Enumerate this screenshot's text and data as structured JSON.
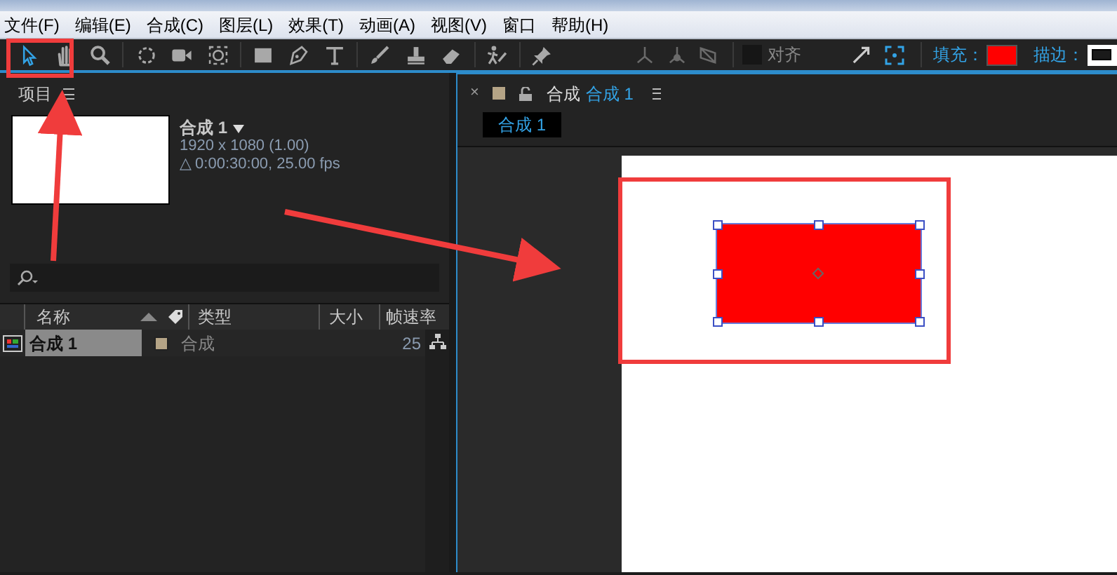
{
  "menu": [
    "文件(F)",
    "编辑(E)",
    "合成(C)",
    "图层(L)",
    "效果(T)",
    "动画(A)",
    "视图(V)",
    "窗口",
    "帮助(H)"
  ],
  "toolbar": {
    "tools": [
      {
        "kind": "selection",
        "selected": true
      },
      {
        "kind": "hand",
        "selected": false
      },
      {
        "kind": "zoom",
        "selected": false
      },
      {
        "kind": "divider"
      },
      {
        "kind": "rotate",
        "selected": false
      },
      {
        "kind": "camera",
        "selected": false
      },
      {
        "kind": "pan",
        "selected": false
      },
      {
        "kind": "divider"
      },
      {
        "kind": "rectangle",
        "selected": false
      },
      {
        "kind": "pen",
        "selected": false
      },
      {
        "kind": "text",
        "selected": false
      },
      {
        "kind": "divider"
      },
      {
        "kind": "brush",
        "selected": false
      },
      {
        "kind": "stamp",
        "selected": false
      },
      {
        "kind": "eraser",
        "selected": false
      },
      {
        "kind": "divider"
      },
      {
        "kind": "roto",
        "selected": false
      },
      {
        "kind": "divider"
      },
      {
        "kind": "pin",
        "selected": false
      }
    ],
    "axes": [
      {
        "kind": "local",
        "disabled": true
      },
      {
        "kind": "world",
        "disabled": true
      },
      {
        "kind": "view",
        "disabled": true
      }
    ],
    "snap": {
      "label": "对齐",
      "checked": false
    },
    "fill": {
      "label": "填充：",
      "color": "#ff0000"
    },
    "stroke": {
      "label": "描边："
    }
  },
  "project_panel": {
    "title": "项目",
    "comp": {
      "name": "合成",
      "number": "1",
      "size": "1920 x 1080 (1.00)",
      "duration": "△ 0:00:30:00, 25.00 fps"
    },
    "columns": [
      "名称",
      "类型",
      "大小",
      "帧速率"
    ],
    "rows": [
      {
        "name": "合成",
        "number": "1",
        "type": "合成",
        "fps": "25",
        "selected": true
      }
    ]
  },
  "viewer": {
    "tab": {
      "close": "×",
      "prefix": "合成",
      "comp": "合成 1"
    },
    "breadcrumb": "合成 1",
    "shape": {
      "color": "#ff0000",
      "selected": true
    }
  }
}
